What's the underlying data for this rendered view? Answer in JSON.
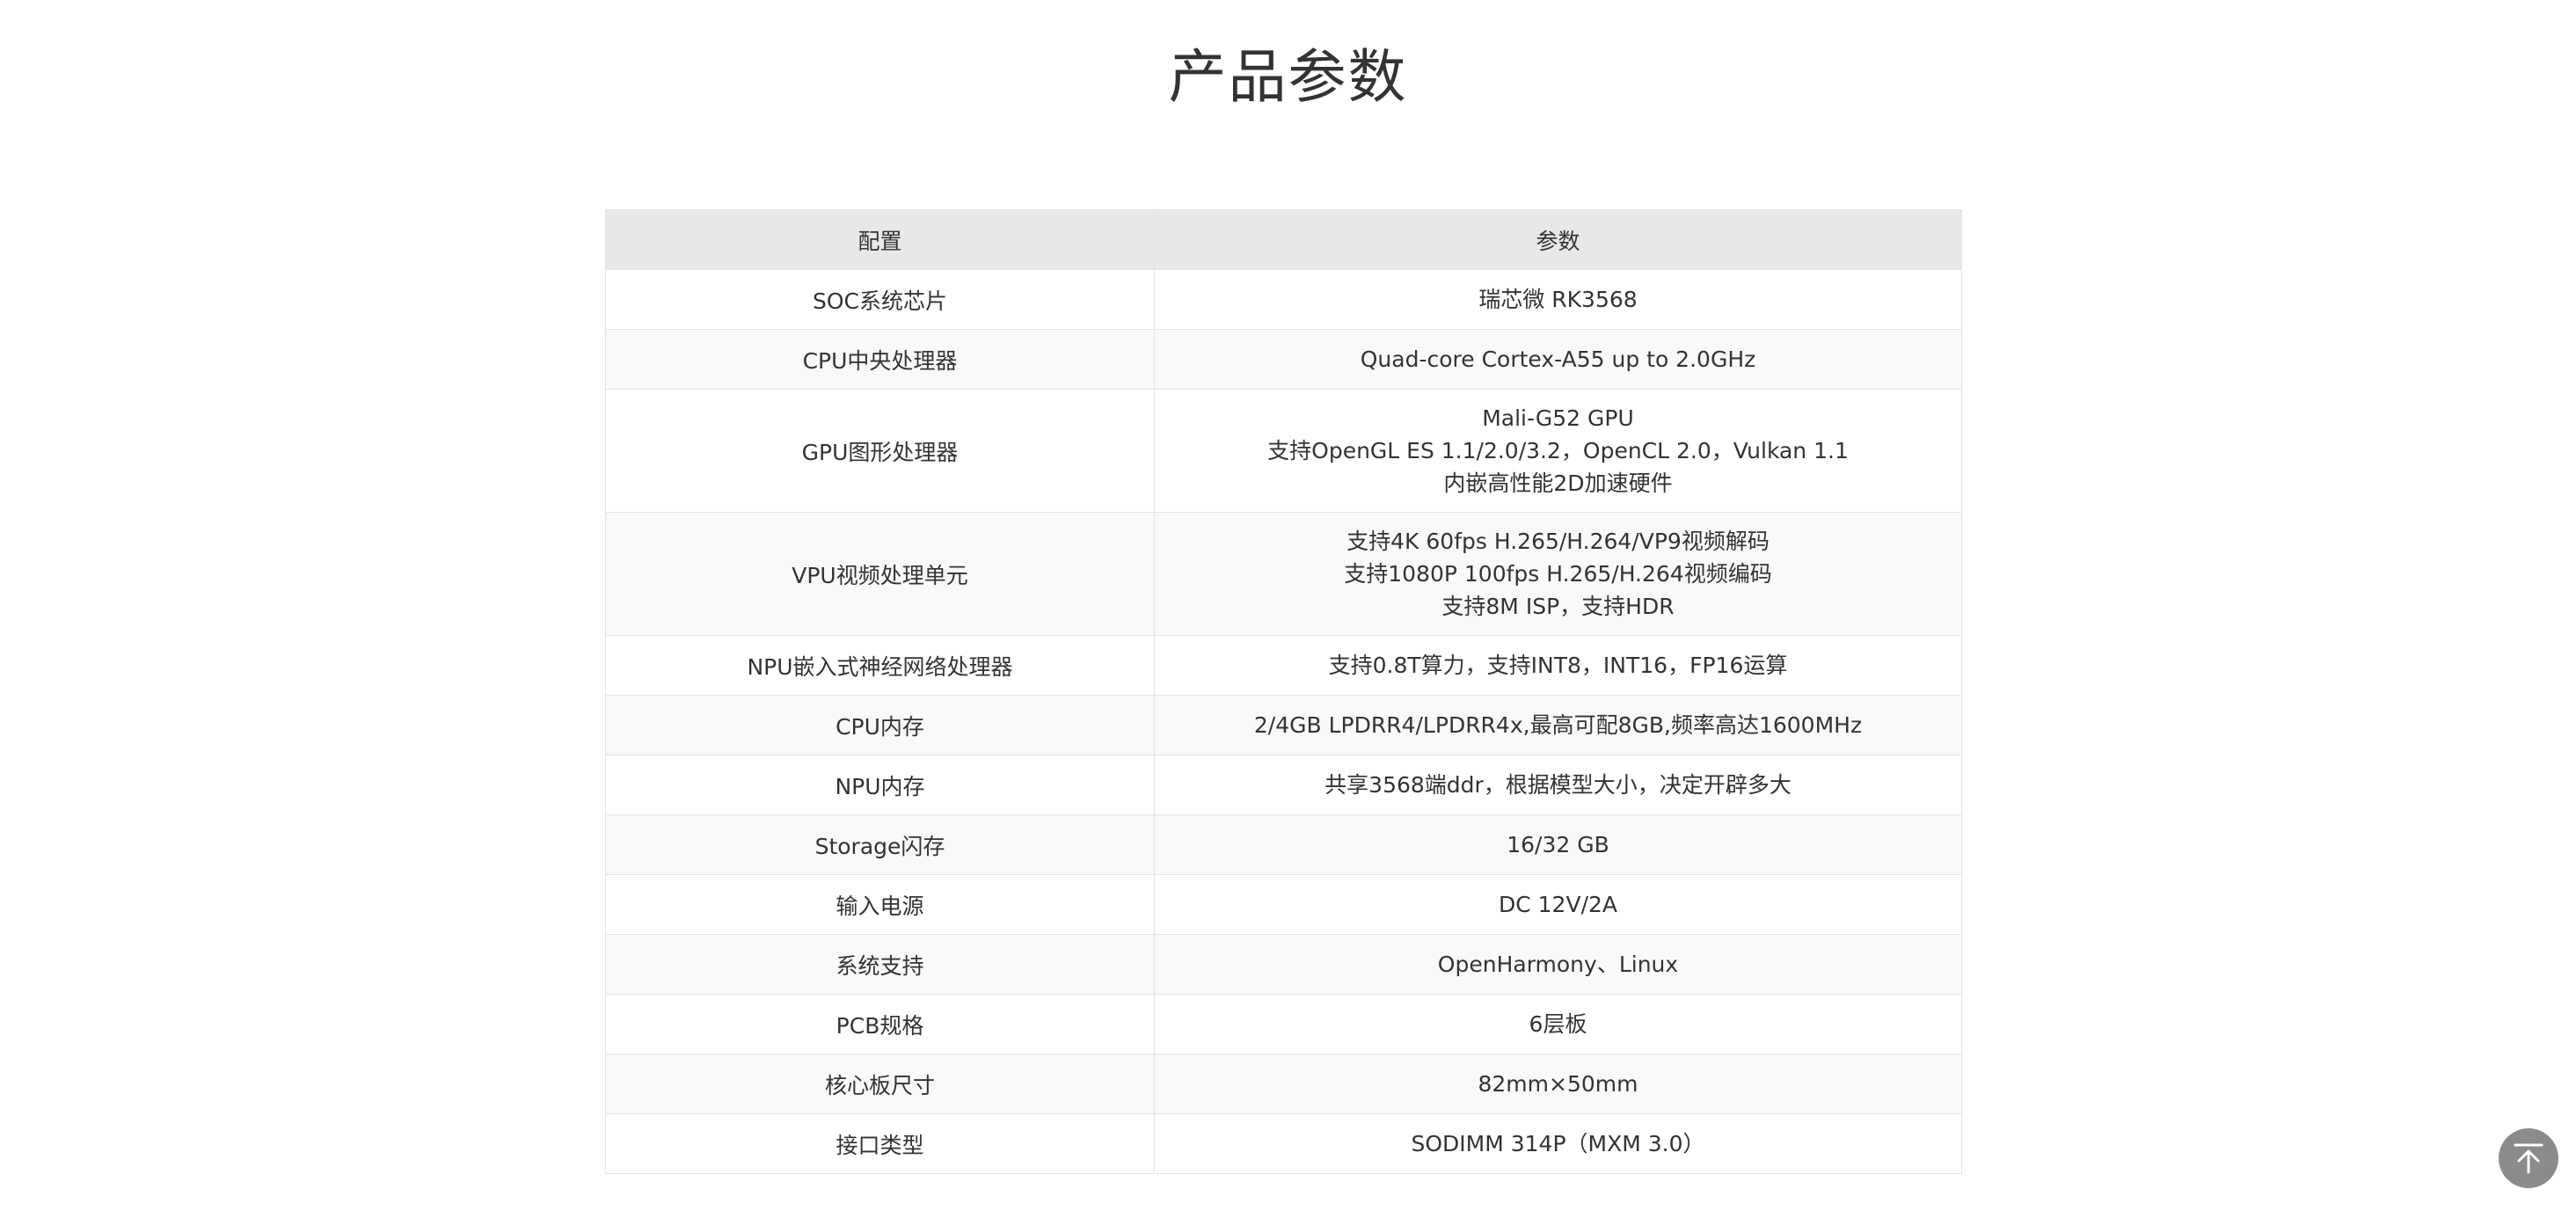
{
  "page": {
    "title": "产品参数"
  },
  "table": {
    "headers": [
      "配置",
      "参数"
    ],
    "rows": [
      {
        "config": "SOC系统芯片",
        "values": [
          "瑞芯微 RK3568"
        ]
      },
      {
        "config": "CPU中央处理器",
        "values": [
          "Quad-core Cortex-A55 up to 2.0GHz"
        ]
      },
      {
        "config": "GPU图形处理器",
        "values": [
          "Mali-G52 GPU",
          "支持OpenGL ES 1.1/2.0/3.2，OpenCL 2.0，Vulkan 1.1",
          "内嵌高性能2D加速硬件"
        ]
      },
      {
        "config": "VPU视频处理单元",
        "values": [
          "支持4K 60fps H.265/H.264/VP9视频解码",
          "支持1080P 100fps H.265/H.264视频编码",
          "支持8M ISP，支持HDR"
        ]
      },
      {
        "config": "NPU嵌入式神经网络处理器",
        "values": [
          "支持0.8T算力，支持INT8，INT16，FP16运算"
        ]
      },
      {
        "config": "CPU内存",
        "values": [
          "2/4GB LPDRR4/LPDRR4x,最高可配8GB,频率高达1600MHz"
        ]
      },
      {
        "config": "NPU内存",
        "values": [
          "共享3568端ddr，根据模型大小，决定开辟多大"
        ]
      },
      {
        "config": "Storage闪存",
        "values": [
          "16/32 GB"
        ]
      },
      {
        "config": "输入电源",
        "values": [
          "DC 12V/2A"
        ]
      },
      {
        "config": "系统支持",
        "values": [
          "OpenHarmony、Linux"
        ]
      },
      {
        "config": "PCB规格",
        "values": [
          "6层板"
        ]
      },
      {
        "config": "核心板尺寸",
        "values": [
          "82mm×50mm"
        ]
      },
      {
        "config": "接口类型",
        "values": [
          "SODIMM 314P（MXM 3.0）"
        ]
      }
    ]
  },
  "back_to_top": {
    "icon": "arrow-up-to-top-icon",
    "color": "#8b8b8b"
  }
}
